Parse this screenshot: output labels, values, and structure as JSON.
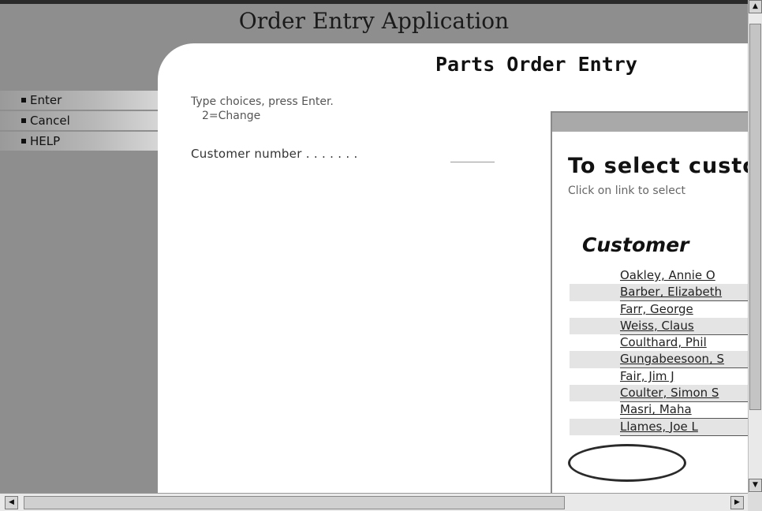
{
  "app": {
    "title": "Order Entry Application"
  },
  "page": {
    "heading": "Parts Order Entry"
  },
  "menu": {
    "items": [
      {
        "label": "Enter"
      },
      {
        "label": "Cancel"
      },
      {
        "label": "HELP"
      }
    ]
  },
  "form": {
    "instruction_line1": "Type choices, press Enter.",
    "instruction_line2": "2=Change",
    "customer_number_label": "Customer number . . . . . . .",
    "customer_number_value": ""
  },
  "popup": {
    "title": "To select custo",
    "subtitle": "Click on link to select",
    "list_heading": "Customer",
    "customers": [
      "Oakley, Annie O",
      "Barber, Elizabeth",
      "Farr, George",
      "Weiss, Claus",
      "Coulthard, Phil",
      "Gungabeesoon, S",
      "Fair, Jim J",
      "Coulter, Simon S",
      "Masri, Maha",
      "Llames, Joe L"
    ]
  },
  "scrollbars": {
    "up_icon": "arrow-up",
    "down_icon": "arrow-down",
    "left_icon": "arrow-left",
    "right_icon": "arrow-right"
  }
}
